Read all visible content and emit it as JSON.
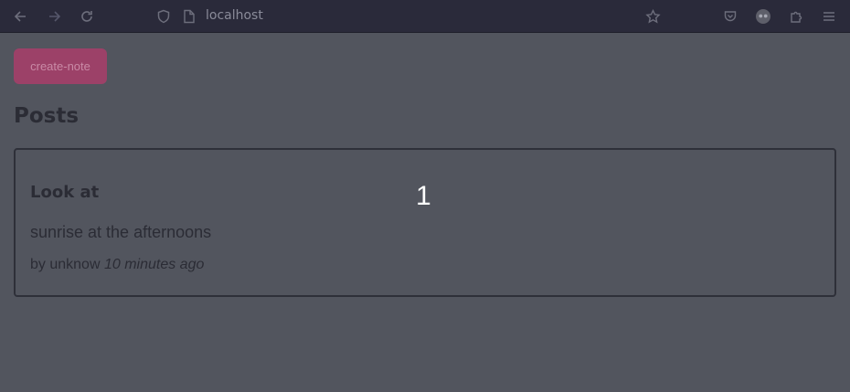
{
  "browser": {
    "url": "localhost",
    "icons": {
      "back": "arrow-left-icon",
      "forward": "arrow-right-icon",
      "reload": "reload-icon",
      "shield": "shield-icon",
      "page": "page-icon",
      "bookmark": "star-icon",
      "pocket": "pocket-icon",
      "account": "account-icon",
      "extensions": "puzzle-icon",
      "menu": "hamburger-icon"
    }
  },
  "page": {
    "create_button_label": "create-note",
    "heading": "Posts",
    "posts": [
      {
        "title": "Look at",
        "body": "sunrise at the afternoons",
        "author_prefix": "by unknow",
        "time_ago": "10 minutes ago"
      }
    ],
    "overlay_number": "1"
  },
  "colors": {
    "background": "#52555e",
    "toolbar": "#2a2a3a",
    "button": "#9c4168",
    "text": "#2b2c35"
  }
}
